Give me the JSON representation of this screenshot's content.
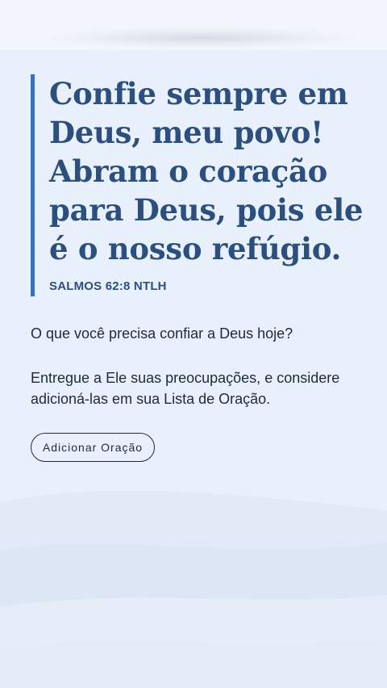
{
  "devotional": {
    "verse": "Confie sempre em Deus, meu povo! Abram o coração para Deus, pois ele é o nosso refúgio.",
    "reference": "SALMOS 62:8 NTLH",
    "question": "O que você precisa confiar a Deus hoje?",
    "body": "Entregue a Ele suas preocupações, e considere adicioná-las em sua Lista de Oração.",
    "add_prayer_label": "Adicionar Oração"
  },
  "colors": {
    "accent": "#3f6fb8",
    "heading": "#2c4f7d",
    "text": "#1f2a36",
    "background": "#e8f0fc"
  }
}
